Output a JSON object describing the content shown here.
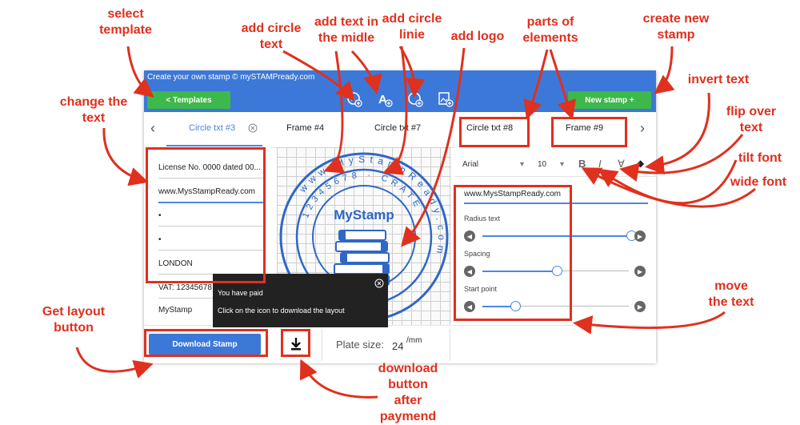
{
  "window": {
    "title": "Create your own stamp © mySTAMPready.com",
    "templates_label": "<  Templates",
    "new_stamp_label": "New stamp +"
  },
  "tabs": [
    {
      "label": "Circle txt #3"
    },
    {
      "label": "Frame #4"
    },
    {
      "label": "Circle txt #7"
    },
    {
      "label": "Circle txt #8"
    },
    {
      "label": "Frame #9"
    }
  ],
  "left_fields": [
    "License No. 0000 dated 00...",
    "www.MysStampReady.com",
    "•",
    "•",
    "LONDON",
    "VAT: 12345678",
    "MyStamp"
  ],
  "stamp": {
    "center_text": "MyStamp",
    "outer_ring_text": "www.MyStampReady.com",
    "inner_ring_text": "12345678 · CRATE",
    "side_text": "License No"
  },
  "font_toolbar": {
    "font": "Arial",
    "size": "10",
    "bold": "B",
    "italic": "I",
    "invert": "∀",
    "fill": "◆"
  },
  "text_editor": {
    "value": "www.MysStampReady.com",
    "radius_label": "Radius text",
    "radius_value": 0.93,
    "spacing_label": "Spacing",
    "spacing_value": 0.47,
    "start_label": "Start point",
    "start_value": 0.22
  },
  "bottom": {
    "download_label": "Download Stamp",
    "plate_label": "Plate size:",
    "plate_value": "24",
    "plate_unit": "/mm"
  },
  "tooltip": {
    "line1": "You have paid",
    "line2": "Click on the icon to download the layout"
  },
  "annotations": {
    "select_template": "select\ntemplate",
    "add_circle_text": "add circle\ntext",
    "add_text_middle": "add text in\nthe midle",
    "add_circle_line": "add circle\nlinie",
    "add_logo": "add logo",
    "parts": "parts of\nelements",
    "create_new": "create new\nstamp",
    "change_text": "change the\ntext",
    "invert_text": "invert text",
    "flip_text": "flip over\ntext",
    "tilt_font": "tilt font",
    "wide_font": "wide font",
    "move_text": "move\nthe text",
    "get_layout": "Get layout\nbutton",
    "download_after": "download\nbutton\nafter\npaymend"
  },
  "colors": {
    "accent": "#3c78d8",
    "green": "#3db84a",
    "annotation": "#e0301e"
  }
}
